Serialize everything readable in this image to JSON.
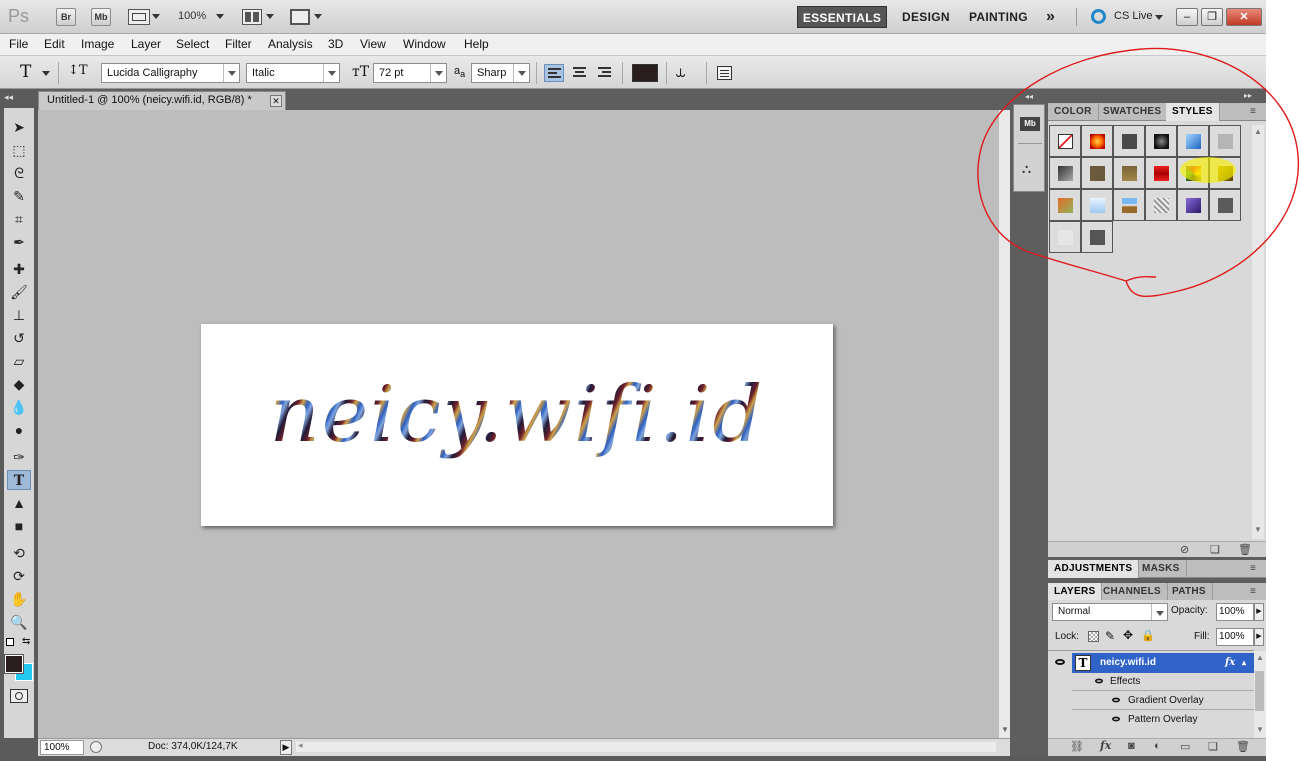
{
  "appbar": {
    "logo": "Ps",
    "br": "Br",
    "mb": "Mb",
    "zoom": "100%",
    "workspaces": [
      "ESSENTIALS",
      "DESIGN",
      "PAINTING"
    ],
    "more": "»",
    "cslive": "CS Live"
  },
  "menu": [
    "File",
    "Edit",
    "Image",
    "Layer",
    "Select",
    "Filter",
    "Analysis",
    "3D",
    "View",
    "Window",
    "Help"
  ],
  "options": {
    "font_family": "Lucida Calligraphy",
    "font_style": "Italic",
    "font_size": "72 pt",
    "aa_label": "a",
    "antialias": "Sharp",
    "text_color": "#2a1d1d"
  },
  "document": {
    "tab_title": "Untitled-1 @ 100% (neicy.wifi.id, RGB/8) *",
    "text": "neicy.wifi.id",
    "zoom": "100%",
    "doc_info": "Doc: 374,0K/124,7K"
  },
  "colors": {
    "foreground": "#2a1d1d",
    "background": "#22c8f0",
    "annotation": "#e01a1a",
    "highlight": "#f6f000"
  },
  "panels": {
    "top_tabs": [
      "COLOR",
      "SWATCHES",
      "STYLES"
    ],
    "active_top_tab": "STYLES",
    "mid_tabs": [
      "ADJUSTMENTS",
      "MASKS"
    ],
    "layer_tabs": [
      "LAYERS",
      "CHANNELS",
      "PATHS"
    ],
    "blend_mode": "Normal",
    "opacity_label": "Opacity:",
    "opacity": "100%",
    "lock_label": "Lock:",
    "fill_label": "Fill:",
    "fill": "100%",
    "layer_name": "neicy.wifi.id",
    "effects_label": "Effects",
    "effects": [
      "Gradient Overlay",
      "Pattern Overlay"
    ]
  }
}
